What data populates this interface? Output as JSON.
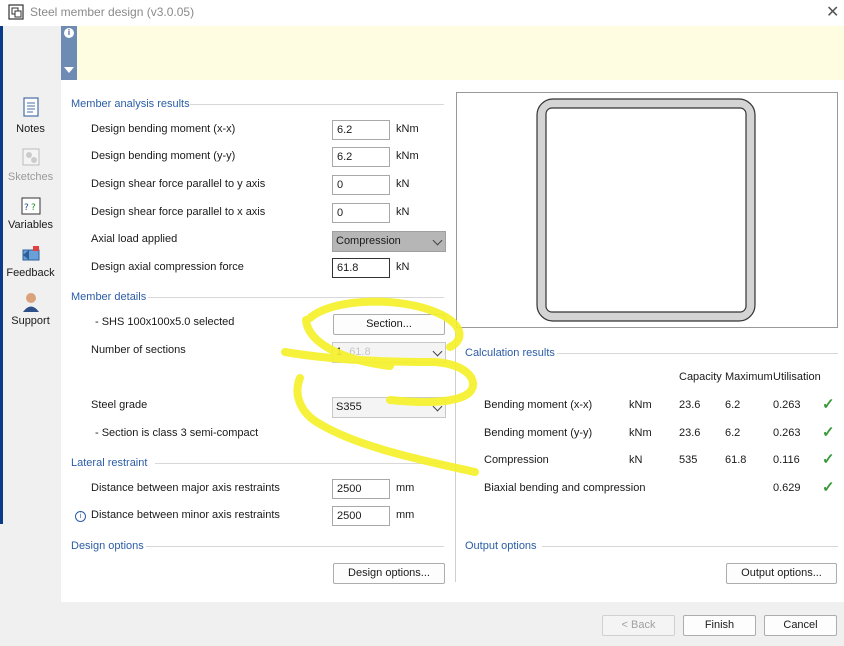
{
  "window": {
    "title": "Steel member design (v3.0.05)",
    "close_glyph": "✕"
  },
  "infobar": {
    "info_glyph": "i"
  },
  "sidebar": {
    "items": [
      {
        "label": "Notes",
        "icon": "notes-icon",
        "enabled": true
      },
      {
        "label": "Sketches",
        "icon": "sketches-icon",
        "enabled": false
      },
      {
        "label": "Variables",
        "icon": "variables-icon",
        "enabled": true
      },
      {
        "label": "Feedback",
        "icon": "feedback-icon",
        "enabled": true
      },
      {
        "label": "Support",
        "icon": "support-icon",
        "enabled": true
      }
    ]
  },
  "analysis": {
    "heading": "Member analysis results",
    "rows": [
      {
        "label": "Design bending moment (x-x)",
        "value": "6.2",
        "unit": "kNm"
      },
      {
        "label": "Design bending moment (y-y)",
        "value": "6.2",
        "unit": "kNm"
      },
      {
        "label": "Design shear force parallel to y axis",
        "value": "0",
        "unit": "kN"
      },
      {
        "label": "Design shear force parallel to x axis",
        "value": "0",
        "unit": "kN"
      }
    ],
    "axial_label": "Axial load applied",
    "axial_value": "Compression",
    "compression_label": "Design axial compression force",
    "compression_value": "61.8",
    "compression_unit": "kN"
  },
  "member": {
    "heading": "Member details",
    "selected_text": "- SHS 100x100x5.0 selected",
    "section_button": "Section...",
    "sections_label": "Number of sections",
    "sections_value": "1",
    "sections_ghost": "61.8",
    "grade_label": "Steel grade",
    "grade_value": "S355",
    "class_text": "- Section is class 3 semi-compact"
  },
  "lateral": {
    "heading": "Lateral restraint",
    "major_label": "Distance between major axis restraints",
    "major_value": "2500",
    "major_unit": "mm",
    "minor_label": "Distance between minor axis restraints",
    "minor_value": "2500",
    "minor_unit": "mm",
    "info_glyph": "i"
  },
  "design_options": {
    "heading": "Design options",
    "button": "Design options..."
  },
  "results": {
    "heading": "Calculation results",
    "columns": [
      "Capacity",
      "Maximum",
      "Utilisation"
    ],
    "rows": [
      {
        "label": "Bending moment (x-x)",
        "unit": "kNm",
        "capacity": "23.6",
        "maximum": "6.2",
        "utilisation": "0.263"
      },
      {
        "label": "Bending moment (y-y)",
        "unit": "kNm",
        "capacity": "23.6",
        "maximum": "6.2",
        "utilisation": "0.263"
      },
      {
        "label": "Compression",
        "unit": "kN",
        "capacity": "535",
        "maximum": "61.8",
        "utilisation": "0.116"
      },
      {
        "label": "Biaxial bending and compression",
        "unit": "",
        "capacity": "",
        "maximum": "",
        "utilisation": "0.629"
      }
    ],
    "check_glyph": "✓"
  },
  "output_options": {
    "heading": "Output options",
    "button": "Output options..."
  },
  "footer": {
    "back": "< Back",
    "finish": "Finish",
    "cancel": "Cancel"
  },
  "colors": {
    "accent": "#2b5da6",
    "check": "#3a9a3a",
    "highlighter": "#f5f02a",
    "infobar": "#fffde1"
  }
}
